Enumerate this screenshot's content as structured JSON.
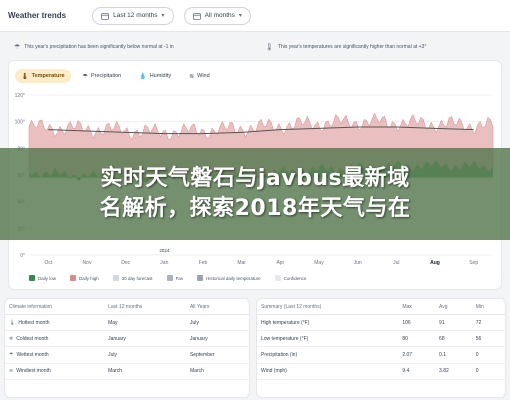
{
  "header": {
    "title": "Weather trends",
    "period_dropdown": "Last 12 months",
    "years_dropdown": "All months"
  },
  "notices": [
    {
      "icon": "precipitation-icon",
      "text": "This year's precipitation has been significantly below normal at -1 in"
    },
    {
      "icon": "thermometer-icon",
      "text": "This year's temperatures are significantly higher than normal at +3°"
    }
  ],
  "tabs": [
    {
      "label": "Temperature",
      "icon": "thermometer-icon",
      "active": true
    },
    {
      "label": "Precipitation",
      "icon": "precipitation-icon",
      "active": false
    },
    {
      "label": "Humidity",
      "icon": "humidity-icon",
      "active": false
    },
    {
      "label": "Wind",
      "icon": "wind-icon",
      "active": false
    }
  ],
  "chart_data": {
    "type": "area",
    "title": "",
    "ylabel": "",
    "ylim": [
      0,
      120
    ],
    "yticks": [
      0,
      20,
      40,
      60,
      80,
      100,
      120
    ],
    "grid": true,
    "year_marker": "2024",
    "categories": [
      "Oct",
      "Nov",
      "Dec",
      "Jan",
      "Feb",
      "Mar",
      "Apr",
      "May",
      "Jun",
      "Jul",
      "Aug",
      "Sep"
    ],
    "highlighted_month": "Aug",
    "series": [
      {
        "name": "Daily low",
        "color": "#2f8f46",
        "values": [
          62,
          60,
          58,
          57,
          58,
          60,
          62,
          64,
          66,
          67,
          67,
          66
        ]
      },
      {
        "name": "Daily high",
        "color": "#d98a8a",
        "values": [
          96,
          95,
          94,
          92,
          93,
          95,
          97,
          99,
          100,
          99,
          98,
          97
        ]
      },
      {
        "name": "Historical daily temperature",
        "color": "#555555",
        "values": [
          94,
          93,
          92,
          91,
          91,
          92,
          94,
          95,
          96,
          96,
          95,
          94
        ]
      }
    ]
  },
  "legend": [
    "Daily low",
    "Daily high",
    "30 day forecast",
    "Fav",
    "Historical daily temperature",
    "Confidence"
  ],
  "legend_colors": [
    "#2f8f46",
    "#d98a8a",
    "#cfd8e3",
    "#a7b4c7",
    "#9ca3af",
    "#e5e7eb"
  ],
  "climate_table": {
    "headers": [
      "Climate information",
      "Last 12 months",
      "All Years"
    ],
    "rows": [
      {
        "icon": "thermometer-icon",
        "label": "Hottest month",
        "last12": "May",
        "all": "July"
      },
      {
        "icon": "snowflake-icon",
        "label": "Coldest month",
        "last12": "January",
        "all": "January"
      },
      {
        "icon": "precipitation-icon",
        "label": "Wettest month",
        "last12": "July",
        "all": "September"
      },
      {
        "icon": "wind-icon",
        "label": "Windiest month",
        "last12": "March",
        "all": "March"
      }
    ]
  },
  "summary_table": {
    "headers": [
      "Summary (Last 12 months)",
      "Max",
      "Avg",
      "Min"
    ],
    "rows": [
      {
        "label": "High temperature (°F)",
        "max": "106",
        "avg": "91",
        "min": "72"
      },
      {
        "label": "Low temperature (°F)",
        "max": "80",
        "avg": "68",
        "min": "56"
      },
      {
        "label": "Precipitation (in)",
        "max": "2.07",
        "avg": "0.1",
        "min": "0"
      },
      {
        "label": "Wind (mph)",
        "max": "9.4",
        "avg": "3.82",
        "min": "0"
      }
    ]
  },
  "banner": {
    "line1": "实时天气磐石与javbus最新域",
    "line2": "名解析，探索2018年天气与在"
  }
}
